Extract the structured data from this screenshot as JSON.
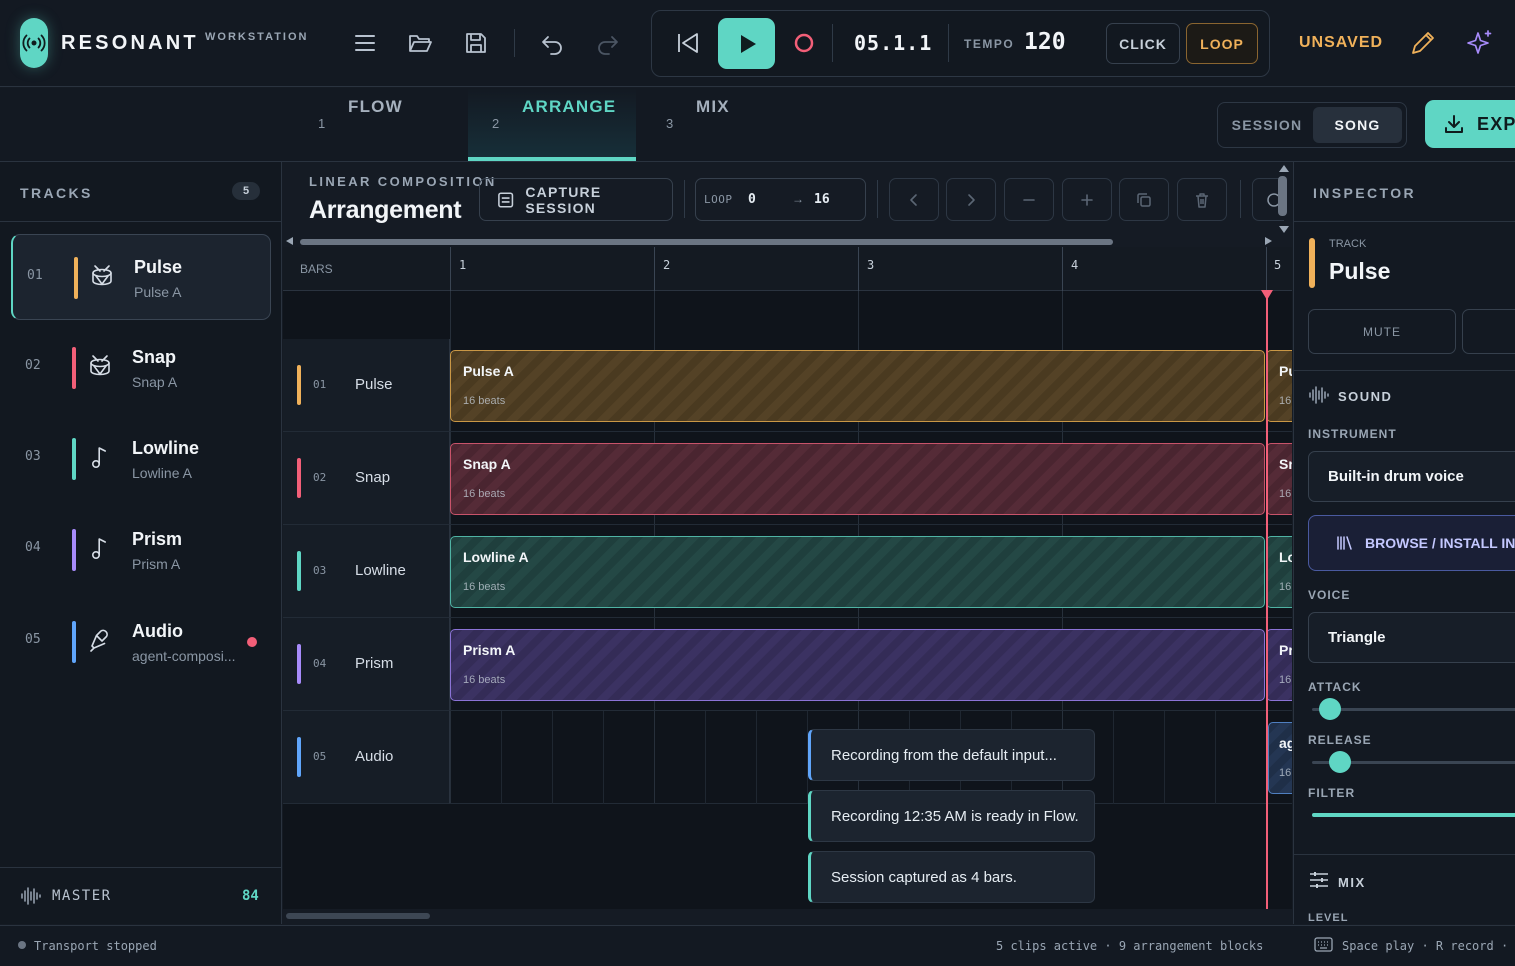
{
  "app": {
    "name": "RESONANT",
    "subtitle": "WORKSTATION"
  },
  "transport": {
    "position": "05.1.1",
    "tempo_label": "TEMPO",
    "tempo": "120",
    "click_label": "CLICK",
    "loop_label": "LOOP"
  },
  "header": {
    "save_state": "UNSAVED"
  },
  "tabs": [
    {
      "label": "FLOW",
      "number": "1"
    },
    {
      "label": "ARRANGE",
      "number": "2"
    },
    {
      "label": "MIX",
      "number": "3"
    }
  ],
  "view_toggle": {
    "session": "SESSION",
    "song": "SONG"
  },
  "export_label": "EXPO",
  "tracks_panel": {
    "title": "TRACKS",
    "count": "5",
    "items": [
      {
        "num": "01",
        "name": "Pulse",
        "clip": "Pulse A",
        "color": "#f0b15a",
        "icon": "drum-icon"
      },
      {
        "num": "02",
        "name": "Snap",
        "clip": "Snap A",
        "color": "#f25f78",
        "icon": "drum-icon"
      },
      {
        "num": "03",
        "name": "Lowline",
        "clip": "Lowline A",
        "color": "#5fd6c4",
        "icon": "music-note-icon"
      },
      {
        "num": "04",
        "name": "Prism",
        "clip": "Prism A",
        "color": "#a78bfa",
        "icon": "music-note-icon"
      },
      {
        "num": "05",
        "name": "Audio",
        "clip": "agent-composi...",
        "color": "#60a5fa",
        "icon": "microphone-icon"
      }
    ],
    "master_label": "MASTER",
    "master_value": "84"
  },
  "arrangement": {
    "eyebrow": "LINEAR COMPOSITION",
    "title": "Arrangement",
    "capture_label": "CAPTURE SESSION",
    "loop_label": "LOOP",
    "loop_start": "0",
    "loop_arrow": "→",
    "loop_end": "16",
    "bars_label": "BARS",
    "bar_numbers": [
      "1",
      "2",
      "3",
      "4",
      "5"
    ],
    "lanes": [
      {
        "num": "01",
        "name": "Pulse",
        "color": "#f0b15a",
        "clip_name": "Pulse A",
        "clip_length": "16 beats",
        "next_clip_name": "Pu",
        "next_clip_length": "16"
      },
      {
        "num": "02",
        "name": "Snap",
        "color": "#f25f78",
        "clip_name": "Snap A",
        "clip_length": "16 beats",
        "next_clip_name": "Sn",
        "next_clip_length": "16"
      },
      {
        "num": "03",
        "name": "Lowline",
        "color": "#5fd6c4",
        "clip_name": "Lowline A",
        "clip_length": "16 beats",
        "next_clip_name": "Lo",
        "next_clip_length": "16"
      },
      {
        "num": "04",
        "name": "Prism",
        "color": "#a78bfa",
        "clip_name": "Prism A",
        "clip_length": "16 beats",
        "next_clip_name": "Pr",
        "next_clip_length": "16"
      },
      {
        "num": "05",
        "name": "Audio",
        "color": "#60a5fa",
        "clip_name": "",
        "clip_length": "",
        "next_clip_name": "ag",
        "next_clip_length": "16"
      }
    ]
  },
  "toasts": [
    {
      "text": "Recording from the default input...",
      "accent": "#60a5fa"
    },
    {
      "text": "Recording 12:35 AM is ready in Flow.",
      "accent": "#5fd6c4"
    },
    {
      "text": "Session captured as 4 bars.",
      "accent": "#5fd6c4"
    }
  ],
  "inspector": {
    "title": "INSPECTOR",
    "track_eyebrow": "TRACK",
    "track_name": "Pulse",
    "mute_label": "MUTE",
    "sound_label": "SOUND",
    "instrument_label": "INSTRUMENT",
    "instrument_value": "Built-in drum voice",
    "browse_label": "BROWSE / INSTALL INST",
    "voice_label": "VOICE",
    "voice_value": "Triangle",
    "attack_label": "ATTACK",
    "attack_level": 0.03,
    "release_label": "RELEASE",
    "release_level": 0.08,
    "filter_label": "FILTER",
    "mix_label": "MIX",
    "level_label": "LEVEL"
  },
  "status": {
    "transport": "Transport stopped",
    "counts": "5 clips active · 9 arrangement blocks",
    "hints": "Space play · R record ·"
  }
}
